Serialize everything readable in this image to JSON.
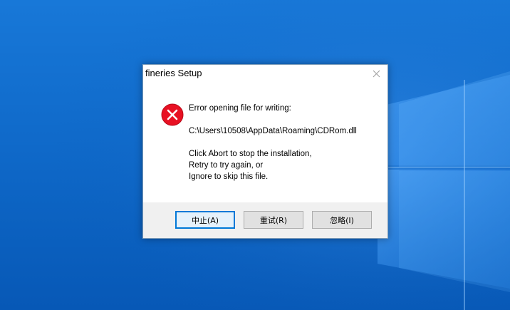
{
  "window": {
    "title": "fineries Setup"
  },
  "message": {
    "line1": "Error opening file for writing:",
    "path": "C:\\Users\\10508\\AppData\\Roaming\\CDRom.dll",
    "line3": "Click Abort to stop the installation,",
    "line4": "Retry to try again, or",
    "line5": "Ignore to skip this file."
  },
  "buttons": {
    "abort": "中止(A)",
    "retry": "重试(R)",
    "ignore": "忽略(I)"
  },
  "icons": {
    "error": "error-icon",
    "close": "close-icon"
  },
  "colors": {
    "desktop": "#0f69c9",
    "error_red": "#e81123",
    "default_button_border": "#0078d7"
  }
}
